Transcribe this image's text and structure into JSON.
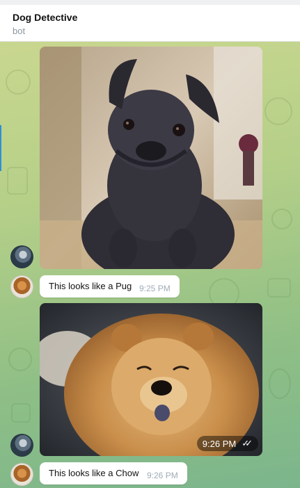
{
  "header": {
    "title": "Dog Detective",
    "subtitle": "bot"
  },
  "messages": [
    {
      "type": "photo",
      "sender": "user",
      "subject": "pug photo"
    },
    {
      "type": "text",
      "sender": "bot",
      "text": "This looks like a Pug",
      "time": "9:25 PM"
    },
    {
      "type": "photo",
      "sender": "user",
      "subject": "chow chow photo",
      "time": "9:26 PM",
      "status_icon": "double-check-icon"
    },
    {
      "type": "text",
      "sender": "bot",
      "text": "This looks like a Chow",
      "time": "9:26 PM"
    }
  ],
  "colors": {
    "chat_background": "#b4cf88",
    "bubble": "#ffffff",
    "time_text": "#a0acb6",
    "accent": "#2e8fd6"
  }
}
